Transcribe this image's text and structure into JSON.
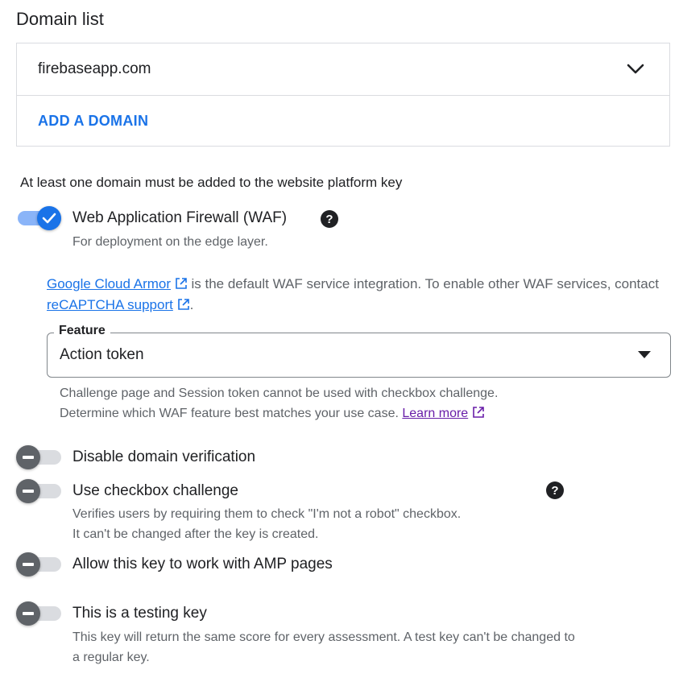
{
  "domain_list": {
    "title": "Domain list",
    "domains": [
      "firebaseapp.com"
    ],
    "add_label": "ADD A DOMAIN",
    "note": "At least one domain must be added to the website platform key"
  },
  "waf": {
    "label": "Web Application Firewall (WAF)",
    "description": "For deployment on the edge layer.",
    "enabled": true,
    "info_link1": "Google Cloud Armor",
    "info_text1": " is the default WAF service integration. To enable other WAF services, contact ",
    "info_link2": "reCAPTCHA support",
    "info_text2": ".",
    "feature": {
      "legend": "Feature",
      "selected": "Action token",
      "help_line1": "Challenge page and Session token cannot be used with checkbox challenge.",
      "help_line2": "Determine which WAF feature best matches your use case.",
      "learn_more": "Learn more"
    }
  },
  "options": [
    {
      "label": "Disable domain verification",
      "enabled": false
    },
    {
      "label": "Use checkbox challenge",
      "enabled": false,
      "desc_line1": "Verifies users by requiring them to check \"I'm not a robot\" checkbox.",
      "desc_line2": "It can't be changed after the key is created."
    },
    {
      "label": "Allow this key to work with AMP pages",
      "enabled": false
    },
    {
      "label": "This is a testing key",
      "enabled": false,
      "desc_line1": "This key will return the same score for every assessment. A test key can't be changed to",
      "desc_line2": "a regular key."
    }
  ],
  "colors": {
    "accent": "#1a73e8",
    "toggle_off": "#5f6368",
    "visited_link": "#681da8"
  },
  "icons": [
    "chevron-down-icon",
    "help-icon",
    "external-link-icon",
    "caret-down-icon",
    "check-icon"
  ]
}
